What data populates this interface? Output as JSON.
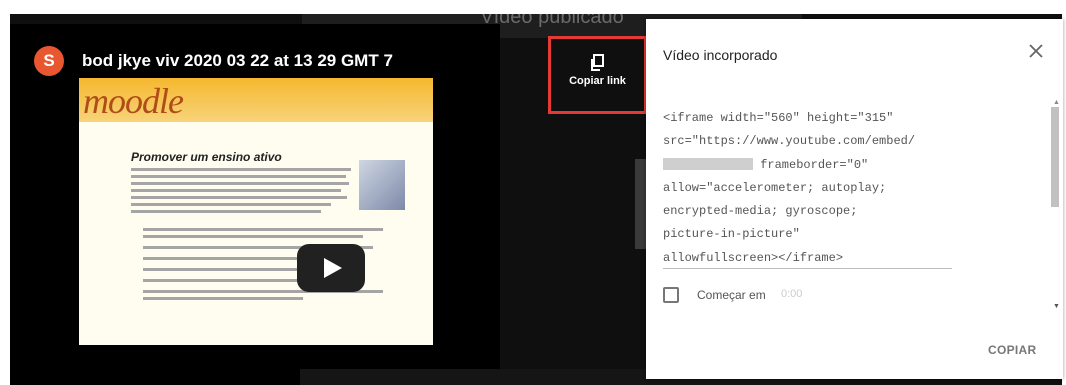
{
  "page": {
    "section_caption": "Vídeo publicado"
  },
  "video": {
    "avatar_letter": "S",
    "title": "bod jkye viv 2020 03 22 at 13 29 GMT 7",
    "thumbnail": {
      "logo_text": "moodle",
      "slide_title": "Promover um ensino ativo"
    }
  },
  "share": {
    "copy_link_label": "Copiar link",
    "copy_icon": "copy-icon"
  },
  "dialog": {
    "title": "Vídeo incorporado",
    "close_icon": "close-icon",
    "embed_code_lines": [
      "<iframe width=\"560\" height=\"315\"",
      "src=\"https://www.youtube.com/embed/",
      "frameborder=\"0\"",
      "allow=\"accelerometer; autoplay;",
      "encrypted-media; gyroscope;",
      "picture-in-picture\"",
      "allowfullscreen></iframe>"
    ],
    "start_at_label": "Começar em",
    "start_at_time": "0:00",
    "copy_button": "COPIAR"
  },
  "colors": {
    "highlight": "#e53935",
    "avatar": "#e8572f"
  }
}
